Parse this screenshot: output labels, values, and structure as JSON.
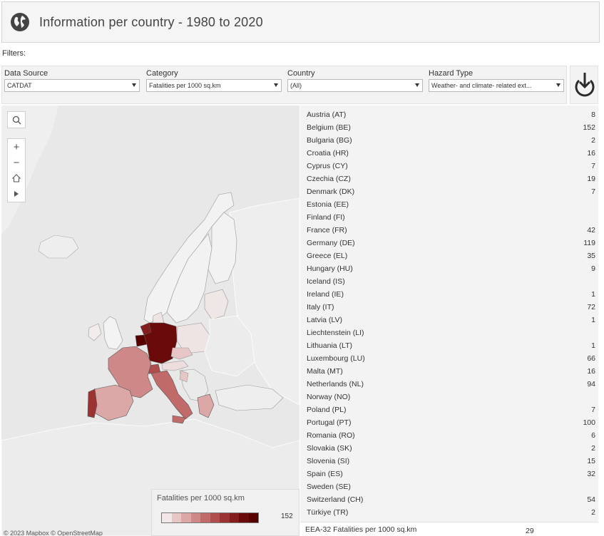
{
  "header": {
    "title": "Information per country - 1980 to 2020",
    "icon": "globe-icon"
  },
  "filters": {
    "label": "Filters:",
    "items": [
      {
        "label": "Data Source",
        "value": "CATDAT"
      },
      {
        "label": "Category",
        "value": "Fatalities per 1000 sq.km"
      },
      {
        "label": "Country",
        "value": "(All)"
      },
      {
        "label": "Hazard Type",
        "value": "Weather- and climate- related ext..."
      }
    ]
  },
  "map": {
    "legend_title": "Fatalities per 1000 sq.km",
    "legend_max": "152",
    "legend_colors": [
      "#f2e6e6",
      "#e7c6c6",
      "#dca7a7",
      "#cf8888",
      "#c06a6a",
      "#b04e4e",
      "#9c3333",
      "#841d1d",
      "#6b0a0a",
      "#560000"
    ],
    "attribution": "© 2023 Mapbox  © OpenStreetMap"
  },
  "table": {
    "rows": [
      {
        "country": "Austria (AT)",
        "value": "8"
      },
      {
        "country": "Belgium (BE)",
        "value": "152"
      },
      {
        "country": "Bulgaria (BG)",
        "value": "2"
      },
      {
        "country": "Croatia (HR)",
        "value": "16"
      },
      {
        "country": "Cyprus (CY)",
        "value": "7"
      },
      {
        "country": "Czechia (CZ)",
        "value": "19"
      },
      {
        "country": "Denmark (DK)",
        "value": "7"
      },
      {
        "country": "Estonia (EE)",
        "value": ""
      },
      {
        "country": "Finland (FI)",
        "value": ""
      },
      {
        "country": "France (FR)",
        "value": "42"
      },
      {
        "country": "Germany (DE)",
        "value": "119"
      },
      {
        "country": "Greece (EL)",
        "value": "35"
      },
      {
        "country": "Hungary (HU)",
        "value": "9"
      },
      {
        "country": "Iceland (IS)",
        "value": ""
      },
      {
        "country": "Ireland (IE)",
        "value": "1"
      },
      {
        "country": "Italy (IT)",
        "value": "72"
      },
      {
        "country": "Latvia (LV)",
        "value": "1"
      },
      {
        "country": "Liechtenstein (LI)",
        "value": ""
      },
      {
        "country": "Lithuania (LT)",
        "value": "1"
      },
      {
        "country": "Luxembourg (LU)",
        "value": "66"
      },
      {
        "country": "Malta (MT)",
        "value": "16"
      },
      {
        "country": "Netherlands (NL)",
        "value": "94"
      },
      {
        "country": "Norway (NO)",
        "value": ""
      },
      {
        "country": "Poland (PL)",
        "value": "7"
      },
      {
        "country": "Portugal (PT)",
        "value": "100"
      },
      {
        "country": "Romania (RO)",
        "value": "6"
      },
      {
        "country": "Slovakia (SK)",
        "value": "2"
      },
      {
        "country": "Slovenia (SI)",
        "value": "15"
      },
      {
        "country": "Spain (ES)",
        "value": "32"
      },
      {
        "country": "Sweden (SE)",
        "value": ""
      },
      {
        "country": "Switzerland (CH)",
        "value": "54"
      },
      {
        "country": "Türkiye (TR)",
        "value": "2"
      }
    ],
    "footer_label": "EEA-32 Fatalities per 1000 sq.km",
    "footer_value": "29"
  }
}
